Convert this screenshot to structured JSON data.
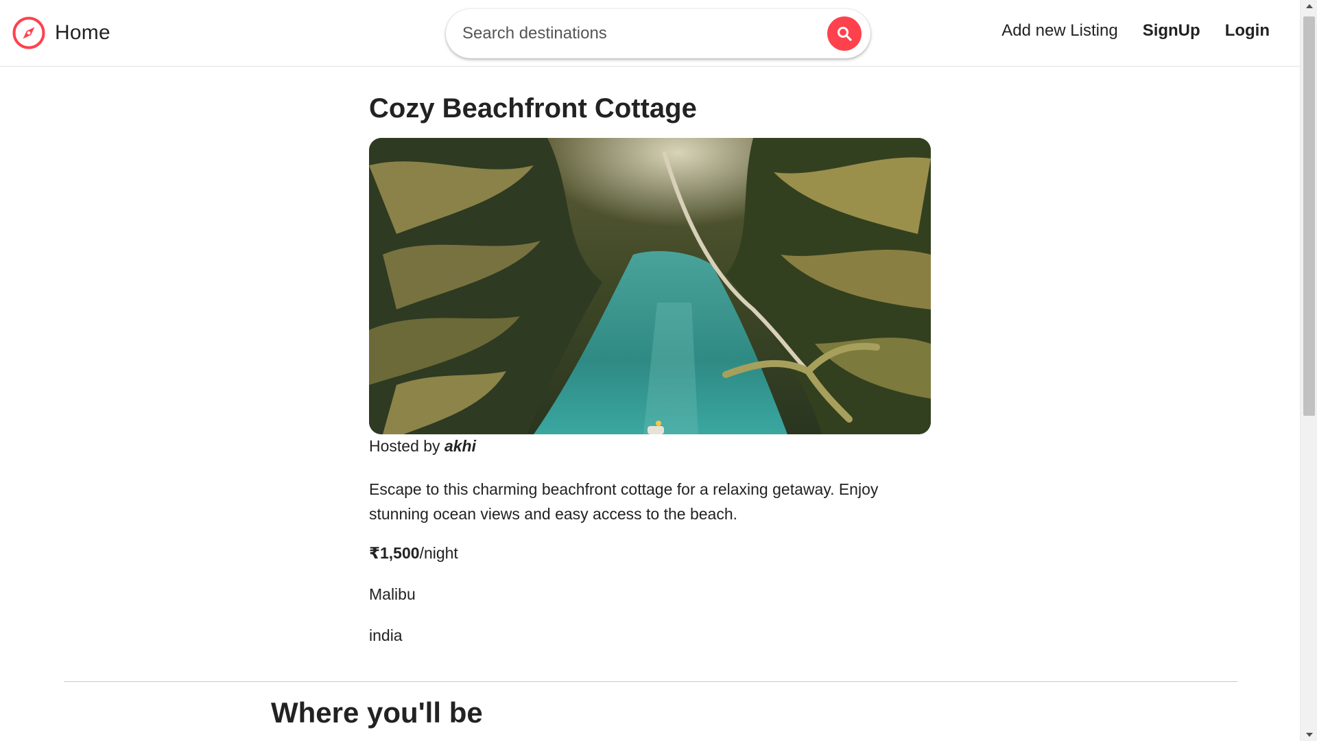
{
  "navbar": {
    "brand_label": "Home",
    "search_placeholder": "Search destinations",
    "links": {
      "add_listing": "Add new Listing",
      "signup": "SignUp",
      "login": "Login"
    },
    "accent_color": "#fe424d"
  },
  "listing": {
    "title": "Cozy Beachfront Cottage",
    "image_subject": "tropical palm-lined lagoon",
    "hosted_by_prefix": "Hosted by",
    "host_name": "akhi",
    "description": "Escape to this charming beachfront cottage for a relaxing getaway. Enjoy stunning ocean views and easy access to the beach.",
    "price": "₹1,500",
    "price_suffix": "/night",
    "location": "Malibu",
    "country": "india"
  },
  "map_section": {
    "heading": "Where you'll be"
  },
  "icons": {
    "brand": "compass-icon",
    "search": "search-icon"
  }
}
